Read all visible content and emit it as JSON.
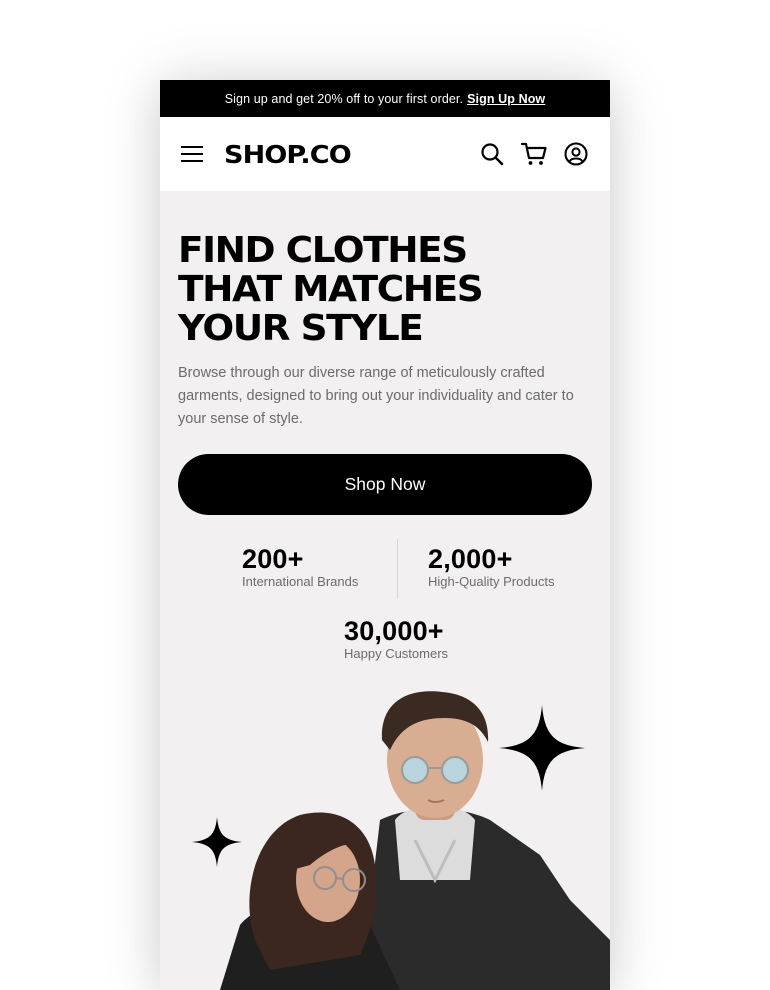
{
  "announcement": {
    "text": "Sign up and get 20% off to your first order.",
    "link_label": "Sign Up Now"
  },
  "header": {
    "logo": "SHOP.CO",
    "icons": [
      "menu-icon",
      "search-icon",
      "cart-icon",
      "account-icon"
    ]
  },
  "hero": {
    "headline_lines": [
      "FIND CLOTHES",
      "THAT MATCHES",
      "YOUR STYLE"
    ],
    "subtext": "Browse through our diverse range of meticulously crafted garments, designed to bring out your individuality and cater to your sense of style.",
    "cta_label": "Shop Now"
  },
  "stats": [
    {
      "value": "200+",
      "label": "International Brands"
    },
    {
      "value": "2,000+",
      "label": "High-Quality Products"
    },
    {
      "value": "30,000+",
      "label": "Happy Customers"
    }
  ],
  "colors": {
    "primary": "#000000",
    "hero_bg": "#f2f0f1",
    "muted_text": "#6b6b6b"
  }
}
